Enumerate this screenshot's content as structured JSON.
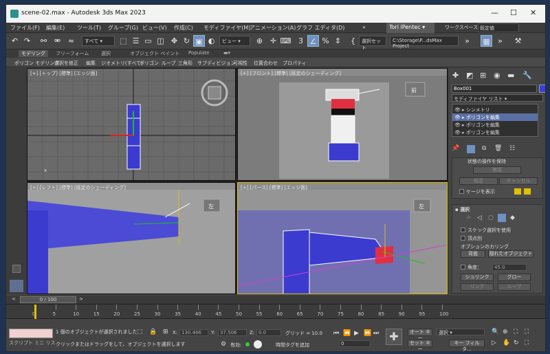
{
  "window": {
    "title": "scene-02.max - Autodesk 3ds Max 2023"
  },
  "menu": [
    "ファイル(F)",
    "編集(E)",
    "ツール(T)",
    "グループ(G)",
    "ビュー(V)",
    "作成(C)",
    "モディファイヤ(M)",
    "アニメーション(A)",
    "グラフ エディタ(D)"
  ],
  "account": {
    "name": "Tori iPentec",
    "workspace_label": "ワークスペース:",
    "workspace_value": "既定値"
  },
  "toolbar": {
    "filter": "すべて",
    "view": "ビュー",
    "selection_set": "選択セット",
    "project_path": "C:\\Storage\\P...dsMax Project"
  },
  "ribbon_tabs": [
    "モデリング",
    "フリーフォーム",
    "選択",
    "オブジェクト ペイント",
    "Populate"
  ],
  "ribbon_items": [
    "ポリゴン モデリング",
    "選択を修正",
    "編集",
    "ジオメトリ(すべて)",
    "ポリゴン",
    "ループ",
    "三角形",
    "サブディビジョン",
    "可視性",
    "位置合わせ",
    "プロパティ"
  ],
  "viewports": [
    {
      "label": "[+] [トップ] [標準] [エッジ面]"
    },
    {
      "label": "[+] [フロント] [標準] [既定のシェーディング]",
      "cube": "前"
    },
    {
      "label": "[+] [レフト] [標準] [既定のシェーディング]",
      "cube": "左"
    },
    {
      "label": "[+] [パース] [標準] [エッジ面]",
      "cube": "左"
    }
  ],
  "command_panel": {
    "object_name": "Box001",
    "modifier_list": "モディファイヤ リスト",
    "stack": [
      "シンメトリ",
      "ポリゴンを編集",
      "ポリゴンを編集",
      "ポリゴンを編集"
    ],
    "rollout_top": "状態の操作を保持",
    "confirm": "確認",
    "set": "設定",
    "cancel": "キャンセル",
    "show_cage": "ケージを表示",
    "selection_title": "選択",
    "by_vertex": "スケック選択を使用",
    "ignore_backface": "頂点別",
    "culling_title": "オプションのカリング",
    "backface": "背面",
    "hidden": "隠れたオブジェクト",
    "angle_label": "角度：",
    "angle_value": "45.0",
    "shrink": "シュリンク",
    "grow": "グロー",
    "ring": "リング",
    "loop": "ループ"
  },
  "timeline": {
    "slider": "0 / 100",
    "ticks": [
      "0",
      "5",
      "10",
      "15",
      "20",
      "25",
      "30",
      "35",
      "40",
      "45",
      "50",
      "55",
      "60",
      "65",
      "70",
      "75",
      "80",
      "85",
      "90",
      "95",
      "100"
    ]
  },
  "status": {
    "script_label": "スクリプト ミニ リス",
    "msg1": "1 個のオブジェクトが選択されました",
    "msg2": "クリックまたはドラッグをして、オブジェクトを選択します",
    "x_label": "X:",
    "x_value": "130.466",
    "y_label": "Y:",
    "y_value": "37.506",
    "z_label": "Z:",
    "z_value": "0.0",
    "grid": "グリッド = 10.0",
    "enabled": "有効:",
    "add_time_tag": "時間タグを追加",
    "auto_key": "オート キー",
    "set_key": "セット キー",
    "selection_dd": "選択",
    "key_filter": "キー フィルタ...",
    "frame": "0"
  }
}
